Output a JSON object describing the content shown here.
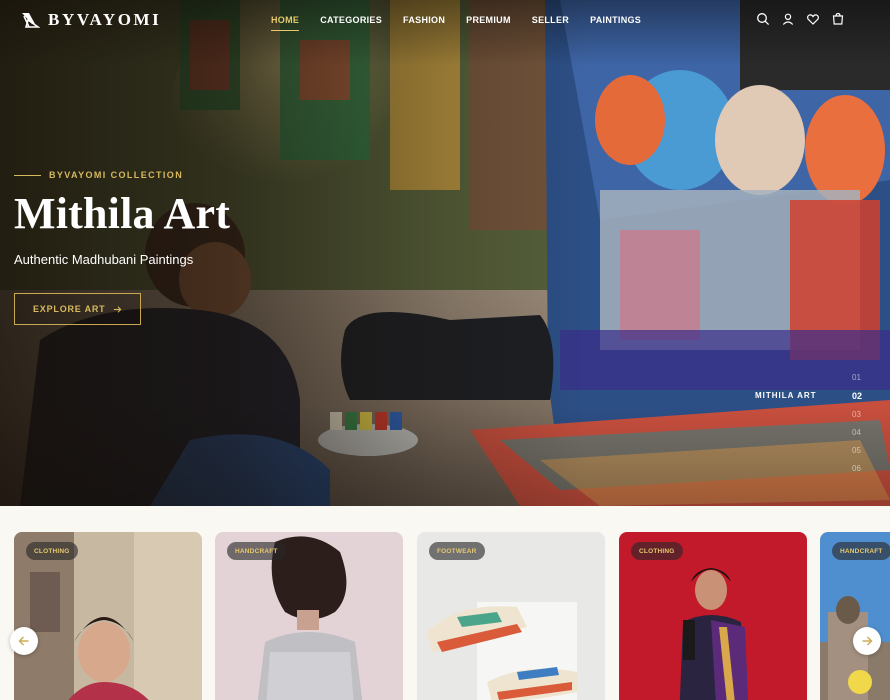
{
  "brand": {
    "name": "BYVAYOMI"
  },
  "nav": {
    "links": [
      {
        "label": "HOME",
        "active": true
      },
      {
        "label": "CATEGORIES",
        "active": false
      },
      {
        "label": "FASHION",
        "active": false
      },
      {
        "label": "PREMIUM",
        "active": false
      },
      {
        "label": "SELLER",
        "active": false
      },
      {
        "label": "PAINTINGS",
        "active": false
      }
    ],
    "icons": [
      "search-icon",
      "user-icon",
      "heart-icon",
      "cart-icon"
    ]
  },
  "hero": {
    "eyebrow": "BYVAYOMI COLLECTION",
    "title": "Mithila Art",
    "subtitle": "Authentic Madhubani Paintings",
    "cta_label": "EXPLORE ART",
    "slide_label": "MITHILA ART",
    "slides": [
      "01",
      "02",
      "03",
      "04",
      "05",
      "06"
    ],
    "active_slide": "02"
  },
  "products": [
    {
      "badge": "CLOTHING"
    },
    {
      "badge": "HANDCRAFT"
    },
    {
      "badge": "FOOTWEAR"
    },
    {
      "badge": "CLOTHING"
    },
    {
      "badge": "HANDCRAFT"
    }
  ],
  "colors": {
    "accent_gold": "#d8b95e",
    "badge_bg": "#3a3a3a",
    "page_bg": "#faf8f3"
  }
}
